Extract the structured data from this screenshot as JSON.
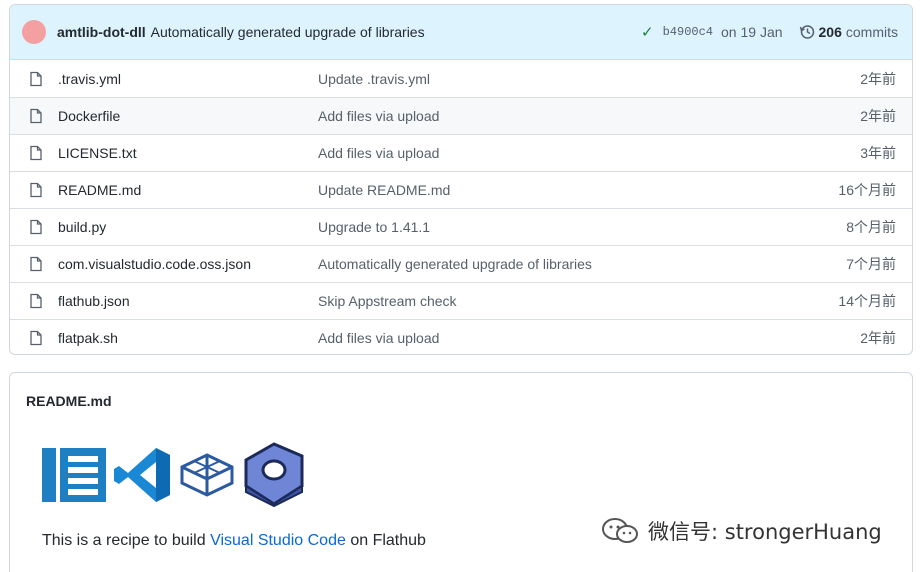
{
  "commit": {
    "author": "amtlib-dot-dll",
    "message": "Automatically generated upgrade of libraries",
    "sha": "b4900c4",
    "date": "on 19 Jan",
    "commit_count": "206",
    "commit_label": "commits"
  },
  "files": [
    {
      "name": ".travis.yml",
      "message": "Update .travis.yml",
      "age": "2年前"
    },
    {
      "name": "Dockerfile",
      "message": "Add files via upload",
      "age": "2年前"
    },
    {
      "name": "LICENSE.txt",
      "message": "Add files via upload",
      "age": "3年前"
    },
    {
      "name": "README.md",
      "message": "Update README.md",
      "age": "16个月前"
    },
    {
      "name": "build.py",
      "message": "Upgrade to 1.41.1",
      "age": "8个月前"
    },
    {
      "name": "com.visualstudio.code.oss.json",
      "message": "Automatically generated upgrade of libraries",
      "age": "7个月前"
    },
    {
      "name": "flathub.json",
      "message": "Skip Appstream check",
      "age": "14个月前"
    },
    {
      "name": "flatpak.sh",
      "message": "Add files via upload",
      "age": "2年前"
    }
  ],
  "readme": {
    "title": "README.md",
    "recipe_prefix": "This is a recipe to build ",
    "recipe_link": "Visual Studio Code",
    "recipe_suffix": " on Flathub"
  },
  "watermark": {
    "text": "微信号: strongerHuang"
  },
  "colors": {
    "accent_link": "#0969da",
    "commit_bar_bg": "#ddf4ff",
    "check_green": "#1a7f37"
  }
}
